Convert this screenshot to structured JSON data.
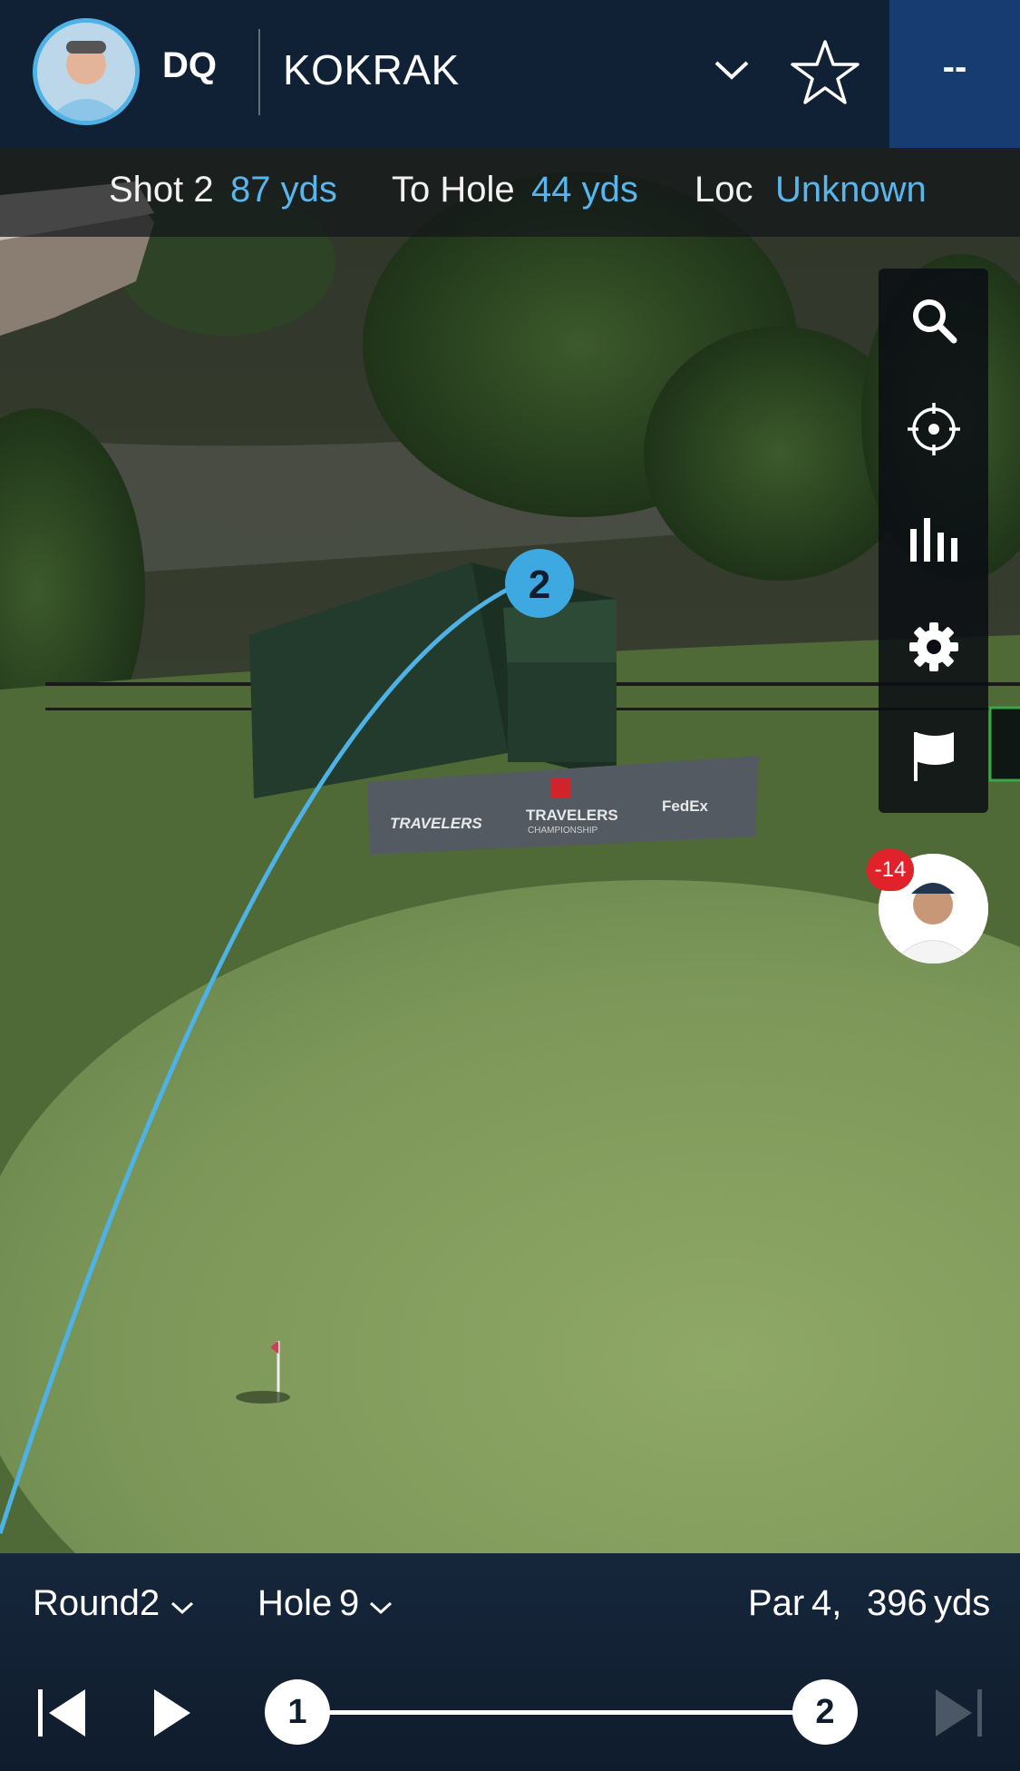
{
  "header": {
    "status": "DQ",
    "player_name": "KOKRAK",
    "score": "--"
  },
  "shot_info": {
    "shot_label": "Shot 2",
    "shot_distance": "87 yds",
    "to_hole_label": "To Hole",
    "to_hole_value": "44 yds",
    "loc_label": "Loc",
    "loc_value": "Unknown"
  },
  "scene": {
    "shot_marker": "2",
    "banner_left": "TRAVELERS",
    "banner_center": "TRAVELERS",
    "banner_center_sub": "CHAMPIONSHIP",
    "banner_right": "FedEx"
  },
  "tools": [
    "search-icon",
    "locate-icon",
    "stats-icon",
    "settings-icon",
    "flag-icon"
  ],
  "leader": {
    "badge": "-14"
  },
  "bottom": {
    "round_label": "Round",
    "round_value": "2",
    "hole_label": "Hole",
    "hole_value": "9",
    "par_label": "Par",
    "par_value": "4,",
    "yards_value": "396",
    "yards_unit": "yds"
  },
  "timeline": {
    "start_marker": "1",
    "end_marker": "2"
  },
  "colors": {
    "accent": "#59b6ec",
    "header_bg": "#0e1e36",
    "score_bg": "#173c72",
    "badge_red": "#e1222a"
  }
}
